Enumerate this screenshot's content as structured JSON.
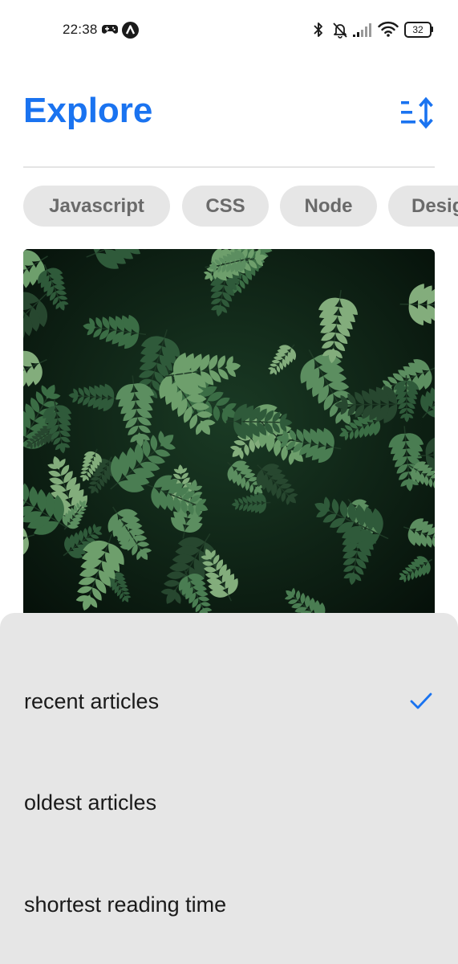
{
  "status_bar": {
    "time": "22:38",
    "battery_level": "32",
    "left_icons": [
      "game-controller-icon",
      "app-a-icon"
    ],
    "right_icons": [
      "bluetooth-icon",
      "muted-bell-icon",
      "cellular-signal-icon",
      "wifi-icon",
      "battery-icon"
    ]
  },
  "header": {
    "title": "Explore",
    "sort_icon": "sort-icon"
  },
  "chips": [
    "Javascript",
    "CSS",
    "Node",
    "Desig"
  ],
  "hero_image": {
    "subject": "green fern leaves"
  },
  "sort_sheet": {
    "options": [
      {
        "label": "recent articles",
        "selected": true
      },
      {
        "label": "oldest articles",
        "selected": false
      },
      {
        "label": "shortest reading time",
        "selected": false
      }
    ]
  },
  "colors": {
    "accent": "#1a73f0",
    "chip_bg": "#e6e6e6",
    "chip_text": "#6a6a6a",
    "sheet_bg": "#e6e6e6",
    "text": "#1a1a1a"
  }
}
